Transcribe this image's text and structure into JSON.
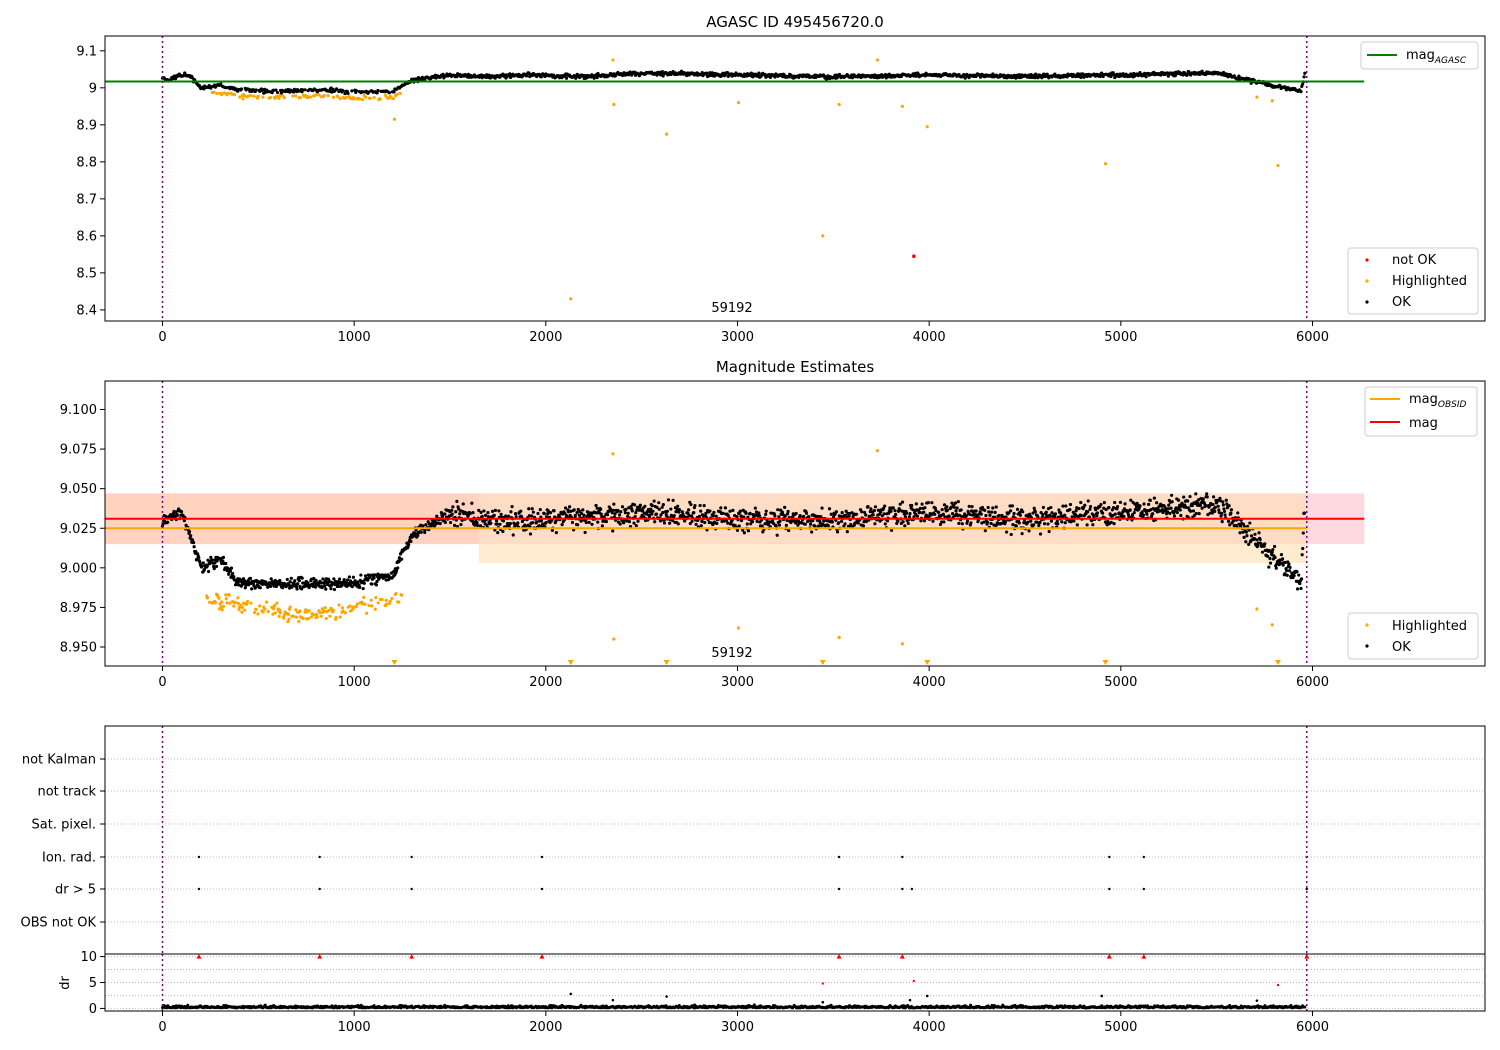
{
  "chart_data": [
    {
      "type": "scatter",
      "title": "AGASC ID 495456720.0",
      "annotation": "59192",
      "xlim": [
        -300,
        6900
      ],
      "ylim": [
        8.37,
        9.14
      ],
      "x_ticks": [
        0,
        1000,
        2000,
        3000,
        4000,
        5000,
        6000
      ],
      "y_ticks": [
        8.4,
        8.5,
        8.6,
        8.7,
        8.8,
        8.9,
        9.0,
        9.1
      ],
      "vlines": [
        0,
        5970
      ],
      "lines": [
        {
          "name": "mag",
          "subscript": "AGASC",
          "value": 9.017,
          "x_range": [
            -300,
            6270
          ],
          "color": "#008000"
        }
      ],
      "legend_top": [
        {
          "label": "mag",
          "subscript": "AGASC",
          "color": "#008000"
        }
      ],
      "legend_bottom": [
        {
          "label": "not OK",
          "color": "#ff0000"
        },
        {
          "label": "Highlighted",
          "color": "#ffa500"
        },
        {
          "label": "OK",
          "color": "#000000"
        }
      ],
      "series": [
        {
          "name": "OK",
          "color": "#000000",
          "points": [
            [
              0,
              9.03
            ],
            [
              30,
              9.02
            ],
            [
              100,
              9.035
            ],
            [
              150,
              9.03
            ],
            [
              200,
              9.0
            ],
            [
              300,
              9.005
            ],
            [
              400,
              8.995
            ],
            [
              600,
              8.99
            ],
            [
              800,
              8.995
            ],
            [
              1000,
              8.99
            ],
            [
              1200,
              8.99
            ],
            [
              1300,
              9.02
            ],
            [
              1500,
              9.035
            ],
            [
              1700,
              9.03
            ],
            [
              1900,
              9.035
            ],
            [
              2200,
              9.03
            ],
            [
              2500,
              9.04
            ],
            [
              3000,
              9.035
            ],
            [
              3500,
              9.03
            ],
            [
              4000,
              9.035
            ],
            [
              4500,
              9.03
            ],
            [
              5000,
              9.035
            ],
            [
              5500,
              9.04
            ],
            [
              5940,
              8.99
            ],
            [
              5960,
              9.04
            ]
          ]
        },
        {
          "name": "Highlighted",
          "color": "#ffa500",
          "points": [
            [
              1210,
              8.915
            ],
            [
              2130,
              8.43
            ],
            [
              2350,
              9.075
            ],
            [
              2355,
              8.955
            ],
            [
              2630,
              8.875
            ],
            [
              3005,
              8.96
            ],
            [
              3445,
              8.6
            ],
            [
              3530,
              8.955
            ],
            [
              3730,
              9.075
            ],
            [
              3860,
              8.95
            ],
            [
              3990,
              8.895
            ],
            [
              4920,
              8.795
            ],
            [
              5710,
              8.975
            ],
            [
              5790,
              8.965
            ],
            [
              5820,
              8.79
            ]
          ]
        },
        {
          "name": "not OK",
          "color": "#ff0000",
          "points": [
            [
              3920,
              8.545
            ]
          ]
        }
      ]
    },
    {
      "type": "scatter",
      "title": "Magnitude Estimates",
      "annotation": "59192",
      "xlim": [
        -300,
        6900
      ],
      "ylim": [
        8.938,
        9.118
      ],
      "x_ticks": [
        0,
        1000,
        2000,
        3000,
        4000,
        5000,
        6000
      ],
      "y_ticks": [
        8.95,
        8.975,
        9.0,
        9.025,
        9.05,
        9.075,
        9.1
      ],
      "y_tick_labels": [
        "8.950",
        "8.975",
        "9.000",
        "9.025",
        "9.050",
        "9.075",
        "9.100"
      ],
      "vlines": [
        0,
        5970
      ],
      "lines": [
        {
          "name": "mag",
          "subscript": "OBSID",
          "value": 9.025,
          "x_range": [
            -300,
            5970
          ],
          "color": "#ffa500"
        },
        {
          "name": "mag",
          "value": 9.031,
          "x_range": [
            -300,
            6270
          ],
          "color": "#ff0000"
        }
      ],
      "bands": [
        {
          "y_range": [
            9.015,
            9.047
          ],
          "x_range": [
            -300,
            6270
          ],
          "color": "#ffc0cb"
        },
        {
          "y_range": [
            9.003,
            9.047
          ],
          "x_range": [
            1650,
            5970
          ],
          "color": "#ffe0b0"
        },
        {
          "y_range": [
            9.015,
            9.047
          ],
          "x_range": [
            -300,
            1650
          ],
          "color": "#ffcfa8"
        }
      ],
      "legend_top": [
        {
          "label": "mag",
          "subscript": "OBSID",
          "color": "#ffa500"
        },
        {
          "label": "mag",
          "color": "#ff0000"
        }
      ],
      "legend_bottom": [
        {
          "label": "Highlighted",
          "color": "#ffa500"
        },
        {
          "label": "OK",
          "color": "#000000"
        }
      ],
      "series": [
        {
          "name": "OK",
          "color": "#000000",
          "points": [
            [
              0,
              9.03
            ],
            [
              100,
              9.035
            ],
            [
              200,
              9.0
            ],
            [
              300,
              9.005
            ],
            [
              400,
              8.99
            ],
            [
              600,
              8.99
            ],
            [
              800,
              8.99
            ],
            [
              1000,
              8.99
            ],
            [
              1200,
              8.995
            ],
            [
              1300,
              9.02
            ],
            [
              1500,
              9.035
            ],
            [
              1700,
              9.03
            ],
            [
              2000,
              9.03
            ],
            [
              2500,
              9.035
            ],
            [
              3000,
              9.03
            ],
            [
              3500,
              9.03
            ],
            [
              4000,
              9.035
            ],
            [
              4500,
              9.03
            ],
            [
              5000,
              9.035
            ],
            [
              5500,
              9.04
            ],
            [
              5940,
              8.99
            ],
            [
              5960,
              9.04
            ]
          ]
        },
        {
          "name": "Highlighted",
          "color": "#ffa500",
          "points": [
            [
              250,
              8.98
            ],
            [
              500,
              8.975
            ],
            [
              700,
              8.97
            ],
            [
              900,
              8.972
            ],
            [
              1100,
              8.978
            ],
            [
              1250,
              8.98
            ],
            [
              2350,
              9.072
            ],
            [
              2355,
              8.955
            ],
            [
              3005,
              8.962
            ],
            [
              3530,
              8.956
            ],
            [
              3730,
              9.074
            ],
            [
              3860,
              8.952
            ],
            [
              5710,
              8.974
            ],
            [
              5790,
              8.964
            ]
          ]
        },
        {
          "name": "Highlighted (below axis)",
          "color": "#ffa500",
          "marker": "triangle-down",
          "points": [
            [
              1210,
              8.94
            ],
            [
              2130,
              8.94
            ],
            [
              2630,
              8.94
            ],
            [
              3445,
              8.94
            ],
            [
              3990,
              8.94
            ],
            [
              4920,
              8.94
            ],
            [
              5820,
              8.94
            ]
          ]
        }
      ]
    },
    {
      "type": "scatter",
      "title": "",
      "xlim": [
        -300,
        6900
      ],
      "categories": [
        "not Kalman",
        "not track",
        "Sat. pixel.",
        "Ion. rad.",
        "dr > 5",
        "OBS not OK"
      ],
      "vlines": [
        0,
        5970
      ],
      "series": [
        {
          "name": "Ion. rad.",
          "color": "#000000",
          "x": [
            190,
            820,
            1300,
            1980,
            3530,
            3860,
            4940,
            5120,
            5970
          ]
        },
        {
          "name": "dr > 5",
          "color": "#000000",
          "x": [
            190,
            820,
            1300,
            1980,
            3530,
            3860,
            3910,
            4940,
            5120,
            5970
          ]
        }
      ]
    },
    {
      "type": "scatter",
      "title": "",
      "ylabel": "dr",
      "xlim": [
        -300,
        6900
      ],
      "ylim": [
        -0.5,
        10.5
      ],
      "x_ticks": [
        0,
        1000,
        2000,
        3000,
        4000,
        5000,
        6000
      ],
      "y_ticks": [
        0,
        5,
        10
      ],
      "vlines": [
        0,
        5970
      ],
      "series": [
        {
          "name": "OK",
          "color": "#000000",
          "points": [
            [
              0,
              0.5
            ],
            [
              1000,
              0.3
            ],
            [
              2000,
              0.3
            ],
            [
              3000,
              0.3
            ],
            [
              4000,
              0.3
            ],
            [
              5000,
              0.3
            ],
            [
              5960,
              0.3
            ],
            [
              2130,
              2.8
            ],
            [
              2350,
              1.6
            ],
            [
              2630,
              2.3
            ],
            [
              3445,
              1.2
            ],
            [
              3900,
              1.6
            ],
            [
              3990,
              2.4
            ],
            [
              4900,
              2.4
            ],
            [
              5710,
              1.5
            ]
          ]
        },
        {
          "name": "not OK",
          "color": "#ff0000",
          "marker": "triangle",
          "points": [
            [
              190,
              10
            ],
            [
              820,
              10
            ],
            [
              1300,
              10
            ],
            [
              1980,
              10
            ],
            [
              3530,
              10
            ],
            [
              3860,
              10
            ],
            [
              4940,
              10
            ],
            [
              5120,
              10
            ],
            [
              5970,
              10
            ]
          ]
        },
        {
          "name": "not OK (small)",
          "color": "#ff0000",
          "points": [
            [
              3445,
              4.8
            ],
            [
              3920,
              5.3
            ],
            [
              5820,
              4.5
            ]
          ]
        }
      ]
    }
  ]
}
